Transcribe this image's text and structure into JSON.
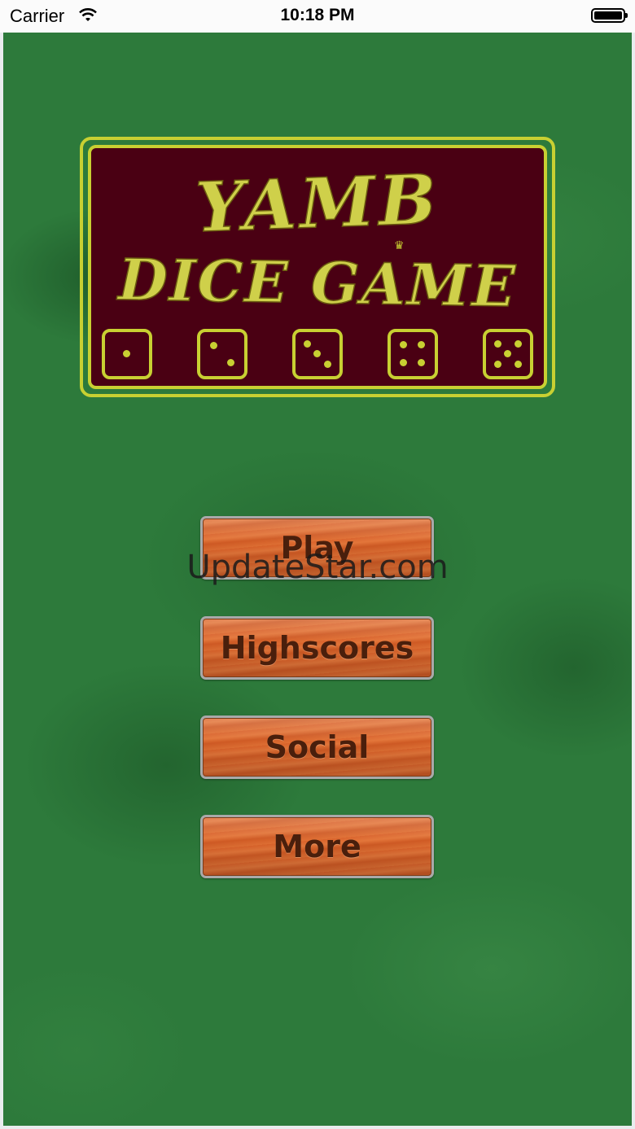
{
  "status_bar": {
    "carrier": "Carrier",
    "time": "10:18 PM"
  },
  "logo": {
    "line1": "YAMB",
    "line2": "DICE GAME",
    "dice_values": [
      1,
      2,
      3,
      4,
      5
    ],
    "colors": {
      "frame": "#c8d032",
      "panel": "#4a0013"
    }
  },
  "menu": {
    "play": "Play",
    "highscores": "Highscores",
    "social": "Social",
    "more": "More"
  },
  "watermark": "UpdateStar.com",
  "colors": {
    "felt": "#2d7a3b",
    "button_wood": "#d86a30"
  }
}
